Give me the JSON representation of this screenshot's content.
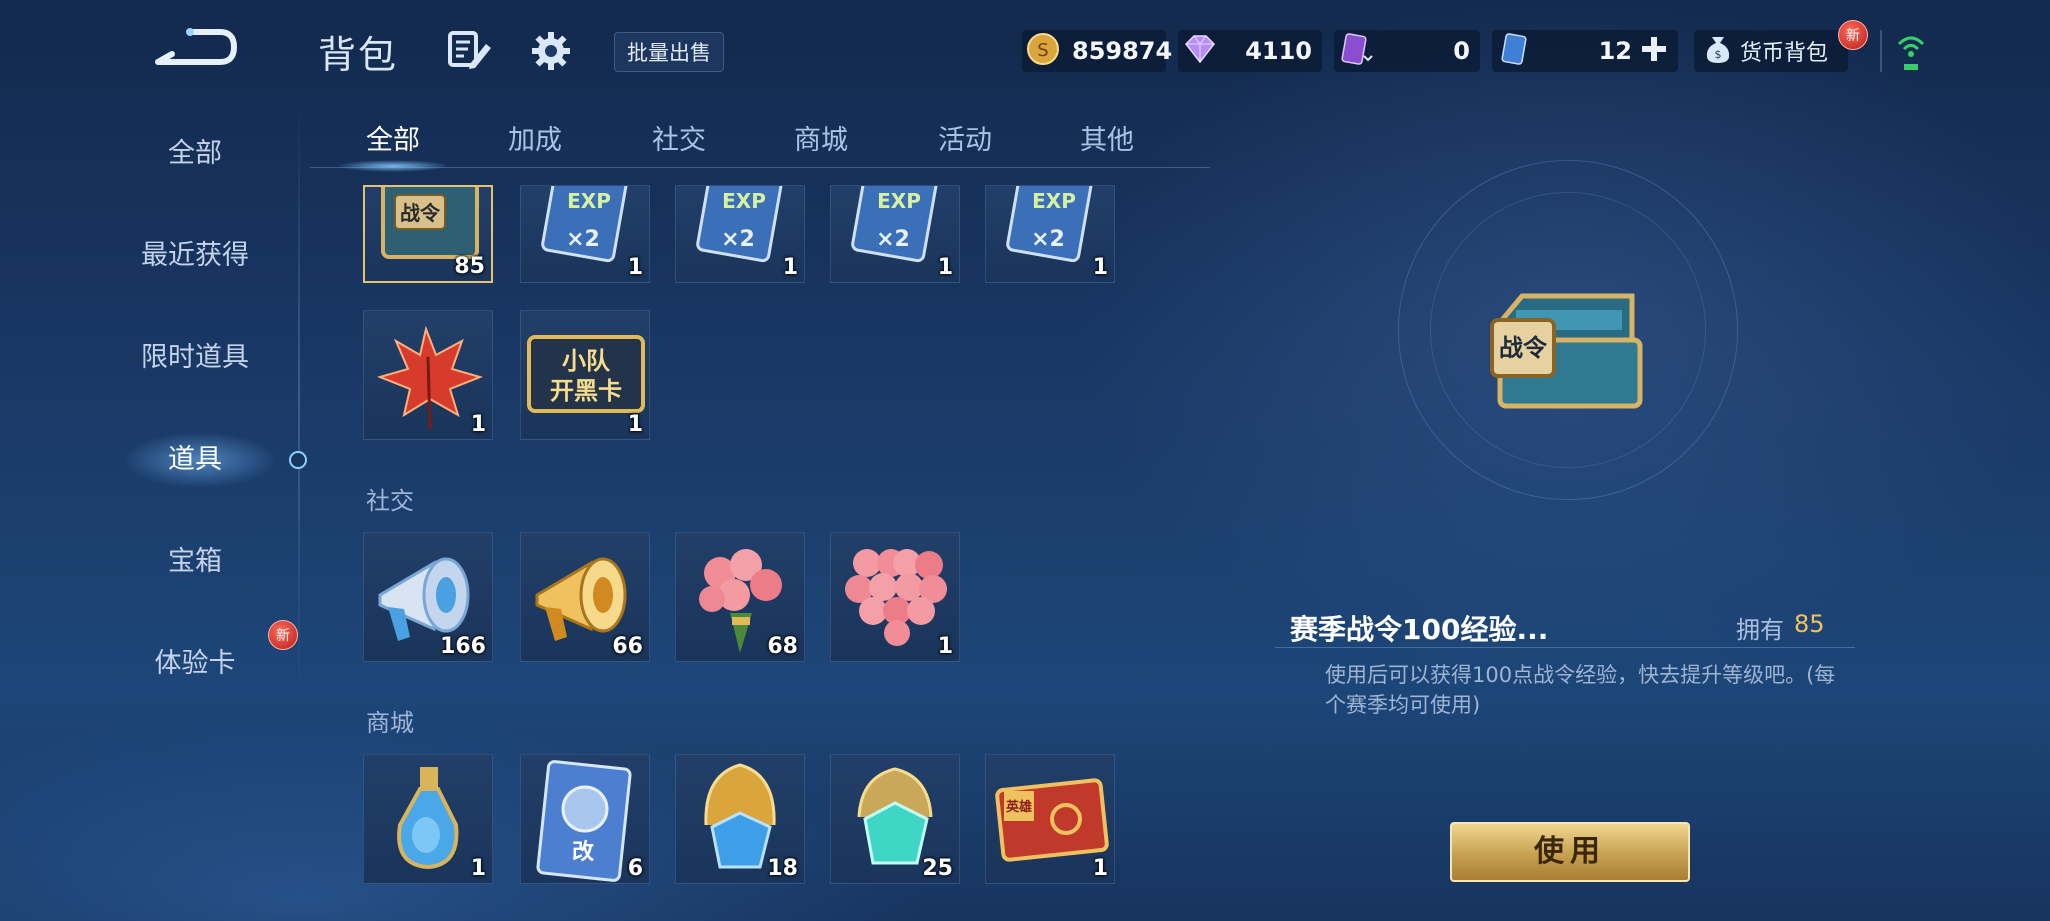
{
  "header": {
    "title": "背包",
    "bulk_sell_label": "批量出售"
  },
  "currencies": {
    "gold": "859874",
    "diamond": "4110",
    "card_a": "0",
    "card_b": "12",
    "wallet_label": "货币背包",
    "wallet_badge": "新"
  },
  "sidebar": {
    "items": [
      {
        "label": "全部"
      },
      {
        "label": "最近获得"
      },
      {
        "label": "限时道具"
      },
      {
        "label": "道具"
      },
      {
        "label": "宝箱"
      },
      {
        "label": "体验卡",
        "badge": "新"
      }
    ]
  },
  "tabs": [
    {
      "label": "全部"
    },
    {
      "label": "加成"
    },
    {
      "label": "社交"
    },
    {
      "label": "商城"
    },
    {
      "label": "活动"
    },
    {
      "label": "其他"
    }
  ],
  "items": {
    "row1": [
      {
        "icon": "battle-pass-chest-icon",
        "count": "85",
        "text": "战令"
      },
      {
        "icon": "exp-x2-card-icon",
        "count": "1",
        "text": "EXP",
        "text2": "×2"
      },
      {
        "icon": "exp-x2-card-icon",
        "count": "1",
        "text": "EXP",
        "text2": "×2"
      },
      {
        "icon": "exp-x2-card-icon",
        "count": "1",
        "text": "EXP",
        "text2": "×2"
      },
      {
        "icon": "exp-x2-card-icon",
        "count": "1",
        "text": "EXP",
        "text2": "×2"
      }
    ],
    "row2": [
      {
        "icon": "maple-leaf-icon",
        "count": "1"
      },
      {
        "icon": "squad-team-card-icon",
        "count": "1",
        "text": "小队",
        "text2": "开黑卡"
      }
    ],
    "social_label": "社交",
    "social": [
      {
        "icon": "silver-megaphone-icon",
        "count": "166"
      },
      {
        "icon": "gold-megaphone-icon",
        "count": "66"
      },
      {
        "icon": "rose-bouquet-icon",
        "count": "68"
      },
      {
        "icon": "heart-rose-bouquet-icon",
        "count": "1"
      }
    ],
    "shop_label": "商城",
    "shop": [
      {
        "icon": "potion-bottle-icon",
        "count": "1"
      },
      {
        "icon": "rename-card-icon",
        "count": "6",
        "text": "改"
      },
      {
        "icon": "gold-crystal-icon",
        "count": "18"
      },
      {
        "icon": "teal-crystal-icon",
        "count": "25"
      },
      {
        "icon": "hero-card-icon",
        "count": "1",
        "text": "英雄"
      }
    ]
  },
  "detail": {
    "chest_text": "战令",
    "name": "赛季战令100经验...",
    "owned_label": "拥有",
    "owned_value": "85",
    "description": "使用后可以获得100点战令经验，快去提升等级吧。(每个赛季均可使用)",
    "use_label": "使用"
  },
  "colors": {
    "accent_gold": "#f0c25f",
    "badge_red": "#d0302a",
    "background": "#1a3a68"
  }
}
